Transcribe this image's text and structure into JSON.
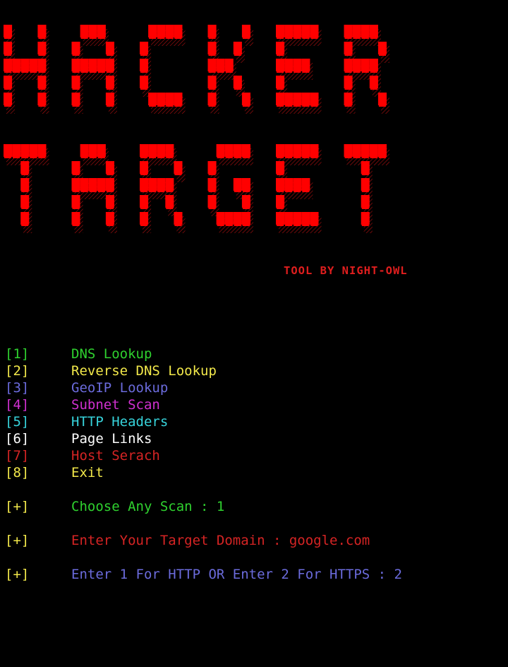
{
  "banner": {
    "lines": [
      "HACKER",
      "TARGET"
    ],
    "color": "#ff0000",
    "style": "ansi-shadow block letters"
  },
  "tagline": "TOOL BY NIGHT-OWL",
  "menu": [
    {
      "index": "[1]",
      "label": "DNS Lookup",
      "color": "green"
    },
    {
      "index": "[2]",
      "label": "Reverse DNS Lookup",
      "color": "yellow"
    },
    {
      "index": "[3]",
      "label": "GeoIP Lookup",
      "color": "blue"
    },
    {
      "index": "[4]",
      "label": "Subnet Scan",
      "color": "magenta"
    },
    {
      "index": "[5]",
      "label": "HTTP Headers",
      "color": "cyan"
    },
    {
      "index": "[6]",
      "label": "Page Links",
      "color": "white"
    },
    {
      "index": "[7]",
      "label": "Host Serach",
      "color": "red"
    },
    {
      "index": "[8]",
      "label": "Exit",
      "color": "yellow"
    }
  ],
  "prompts": [
    {
      "marker": "[+]",
      "text": "Choose Any Scan : 1",
      "color": "green"
    },
    {
      "marker": "[+]",
      "text": "Enter Your Target Domain : google.com",
      "color": "red"
    },
    {
      "marker": "[+]",
      "text": "Enter 1 For HTTP OR Enter 2 For HTTPS : 2",
      "color": "blue"
    }
  ]
}
